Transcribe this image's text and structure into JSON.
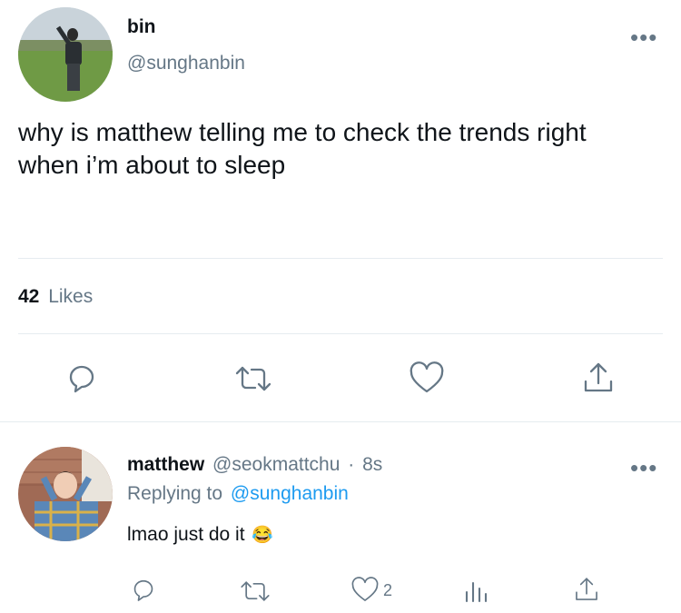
{
  "tweet": {
    "author": {
      "name": "bin",
      "handle": "@sunghanbin"
    },
    "text_lines": [
      "why is matthew telling me to check the trends right",
      "when i’m about to sleep"
    ],
    "likes": {
      "count": "42",
      "label": "Likes"
    },
    "actions": [
      "reply-icon",
      "retweet-icon",
      "like-icon",
      "share-icon"
    ]
  },
  "reply": {
    "author": {
      "name": "matthew",
      "handle": "@seokmattchu",
      "separator": "·",
      "time": "8s"
    },
    "replying_prefix": "Replying to",
    "replying_handle": "@sunghanbin",
    "text": "lmao just do it",
    "emoji": "😂",
    "like_count": "2",
    "actions": [
      "reply-icon",
      "retweet-icon",
      "like-icon",
      "analytics-icon",
      "share-icon"
    ]
  },
  "colors": {
    "link": "#1d9bf0",
    "muted": "#657786",
    "divider": "#e6ecf0",
    "text": "#0f1419"
  }
}
